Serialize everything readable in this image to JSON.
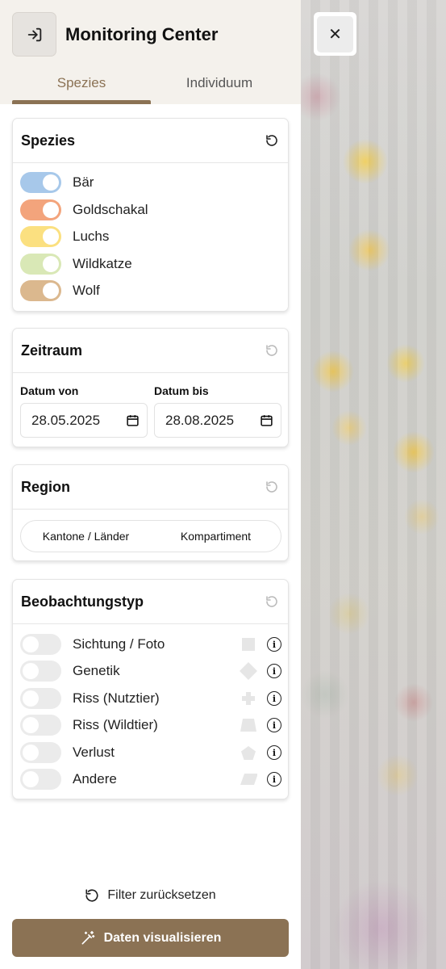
{
  "header": {
    "title": "Monitoring Center",
    "login_icon": "login-icon"
  },
  "tabs": [
    {
      "label": "Spezies",
      "active": true
    },
    {
      "label": "Individuum",
      "active": false
    }
  ],
  "species_card": {
    "title": "Spezies",
    "items": [
      {
        "label": "Bär",
        "enabled": true,
        "color": "#a7c8ea"
      },
      {
        "label": "Goldschakal",
        "enabled": true,
        "color": "#f3a47c"
      },
      {
        "label": "Luchs",
        "enabled": true,
        "color": "#fbe080"
      },
      {
        "label": "Wildkatze",
        "enabled": true,
        "color": "#d9e8b6"
      },
      {
        "label": "Wolf",
        "enabled": true,
        "color": "#dbb88e"
      }
    ]
  },
  "period_card": {
    "title": "Zeitraum",
    "from_label": "Datum von",
    "from_value": "28.05.2025",
    "to_label": "Datum bis",
    "to_value": "28.08.2025"
  },
  "region_card": {
    "title": "Region",
    "segments": [
      "Kantone / Länder",
      "Kompartiment"
    ]
  },
  "observation_card": {
    "title": "Beobachtungstyp",
    "items": [
      {
        "label": "Sichtung / Foto",
        "enabled": false,
        "shape": "square"
      },
      {
        "label": "Genetik",
        "enabled": false,
        "shape": "diamond"
      },
      {
        "label": "Riss (Nutztier)",
        "enabled": false,
        "shape": "cross"
      },
      {
        "label": "Riss (Wildtier)",
        "enabled": false,
        "shape": "trapezoid"
      },
      {
        "label": "Verlust",
        "enabled": false,
        "shape": "pentagon"
      },
      {
        "label": "Andere",
        "enabled": false,
        "shape": "parallelogram"
      }
    ]
  },
  "footer": {
    "reset_label": "Filter zurücksetzen",
    "visualize_label": "Daten visualisieren"
  },
  "colors": {
    "accent": "#8b7254",
    "header_bg": "#f4f1ec"
  }
}
